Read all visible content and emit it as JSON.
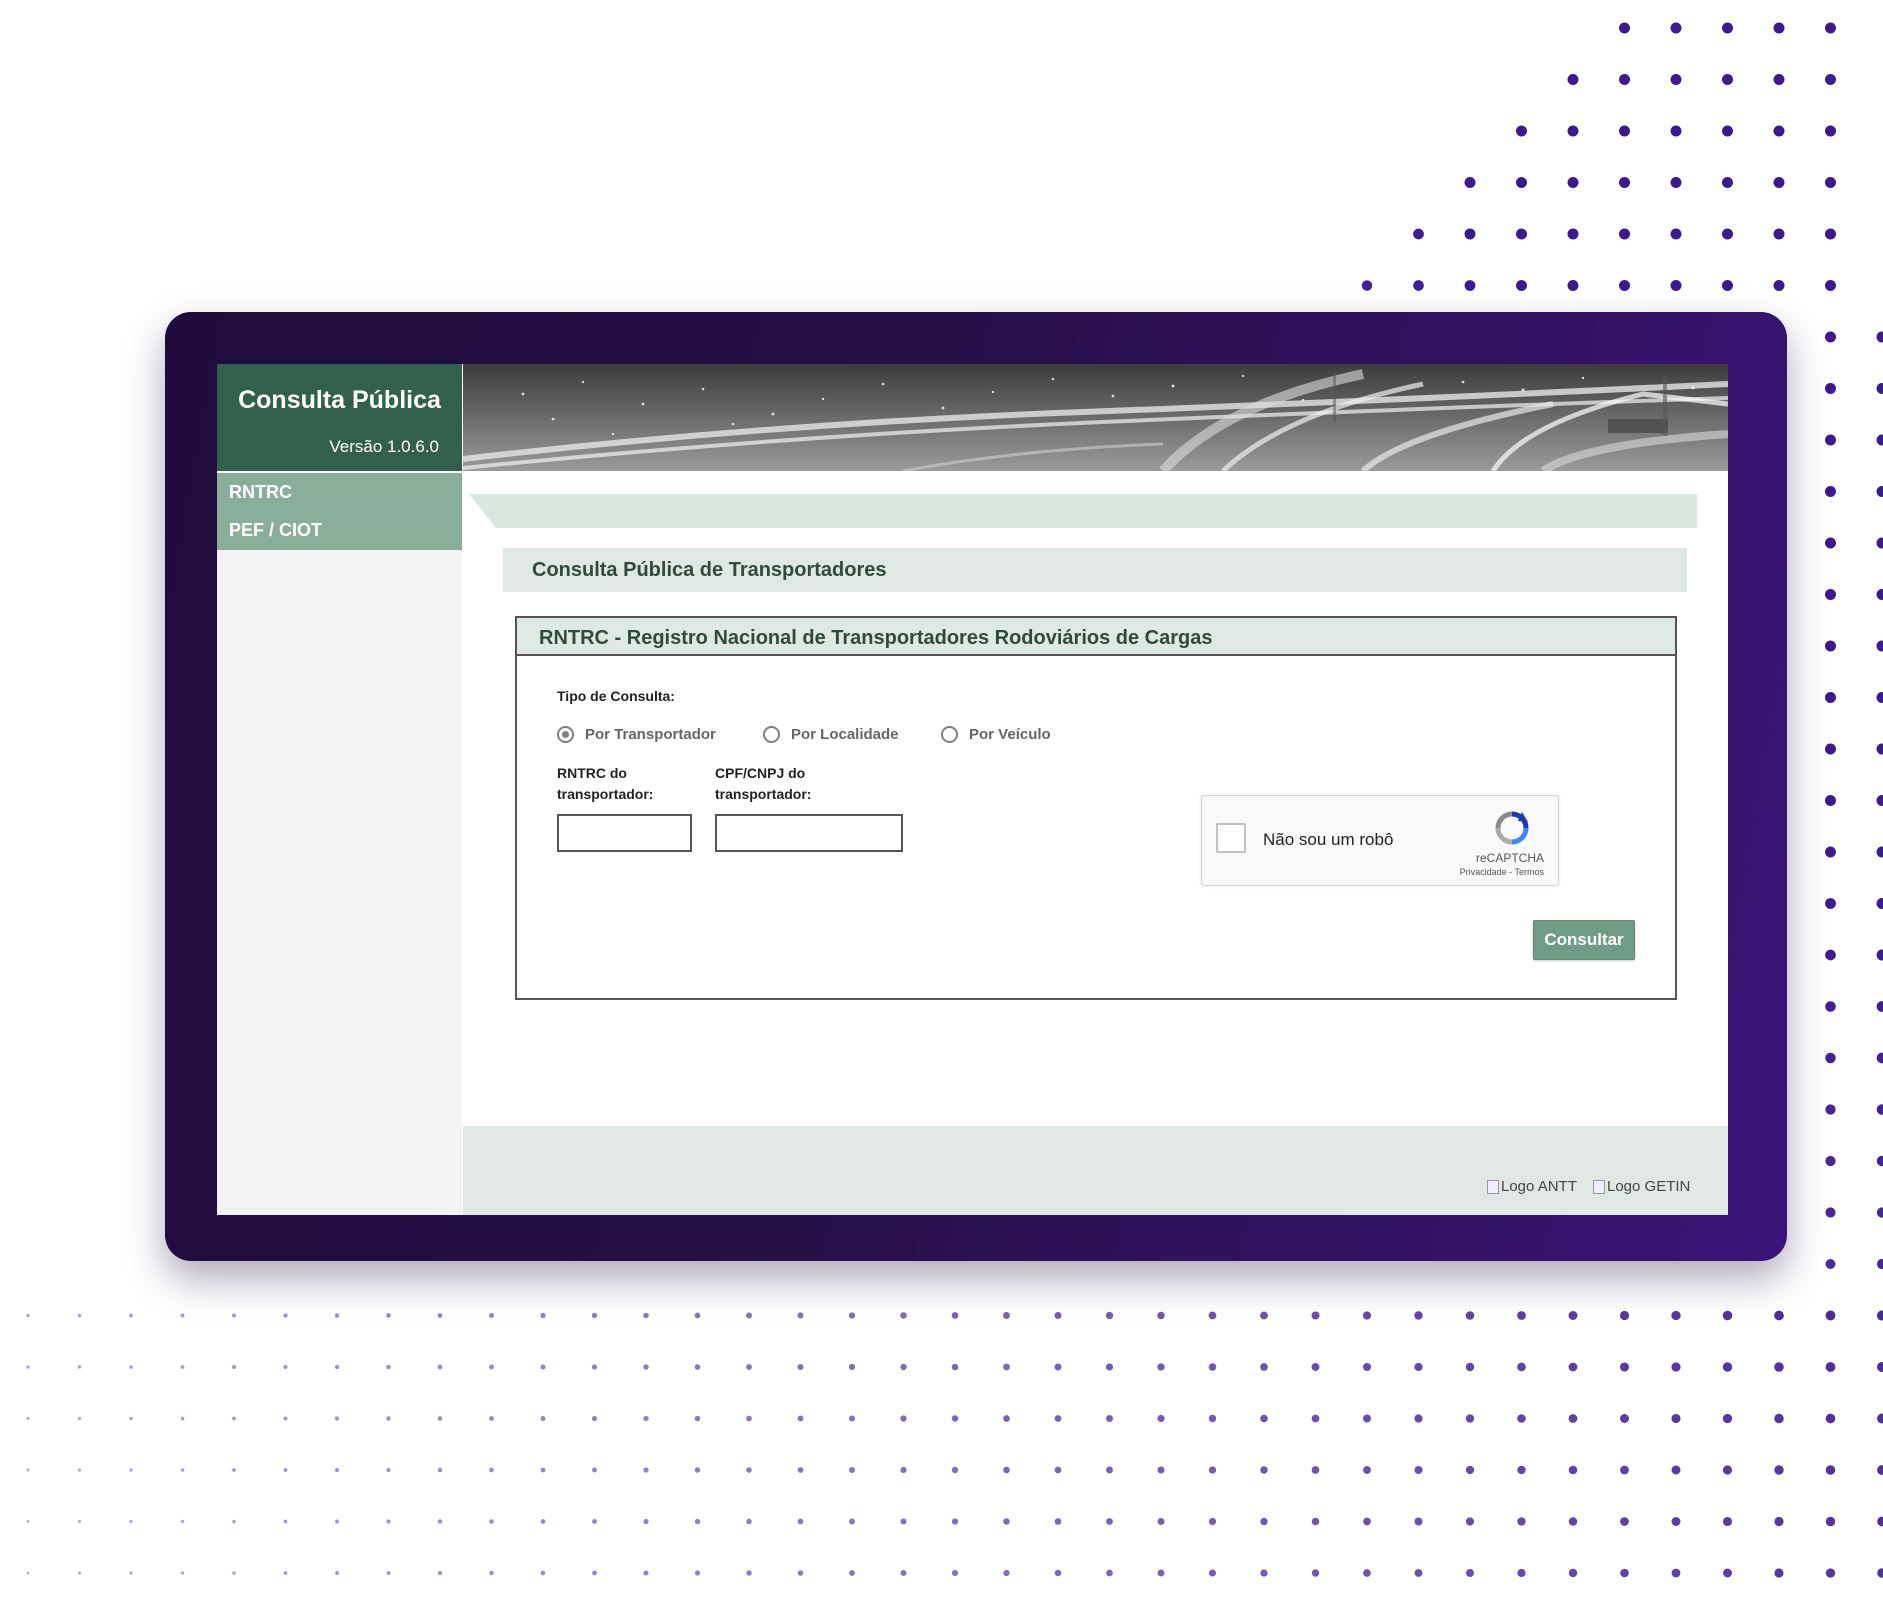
{
  "app": {
    "title": "Consulta Pública",
    "version": "Versão 1.0.6.0"
  },
  "sidebar": {
    "items": [
      {
        "label": "RNTRC"
      },
      {
        "label": "PEF / CIOT"
      }
    ]
  },
  "main": {
    "section_title": "Consulta Pública de Transportadores",
    "panel_title": "RNTRC - Registro Nacional de Transportadores Rodoviários de Cargas",
    "query_type_label": "Tipo de Consulta:",
    "radio_options": [
      {
        "label": "Por Transportador",
        "checked": true
      },
      {
        "label": "Por Localidade",
        "checked": false
      },
      {
        "label": "Por Veículo",
        "checked": false
      }
    ],
    "fields": {
      "rntrc": {
        "label_line1": "RNTRC do",
        "label_line2": "transportador:",
        "value": "",
        "placeholder": ""
      },
      "cpf_cnpj": {
        "label_line1": "CPF/CNPJ do",
        "label_line2": "transportador:",
        "value": "",
        "placeholder": ""
      }
    },
    "captcha": {
      "checkbox_label": "Não sou um robô",
      "brand": "reCAPTCHA",
      "links": "Privacidade - Termos",
      "checked": false
    },
    "submit_label": "Consultar"
  },
  "footer": {
    "logos": [
      {
        "alt": "Logo ANTT"
      },
      {
        "alt": "Logo GETIN"
      }
    ]
  },
  "colors": {
    "frame_dark": "#1f0b3d",
    "frame_accent": "#3a1478",
    "header_green": "#33604a",
    "nav_green": "#8aae98",
    "light_green": "#dde9e2",
    "button_green": "#6f9c85",
    "dot_purple": "#3b1a8c"
  },
  "icons": {
    "radio": "radio-icon",
    "recaptcha": "recaptcha-icon",
    "broken_image": "broken-image-icon"
  }
}
